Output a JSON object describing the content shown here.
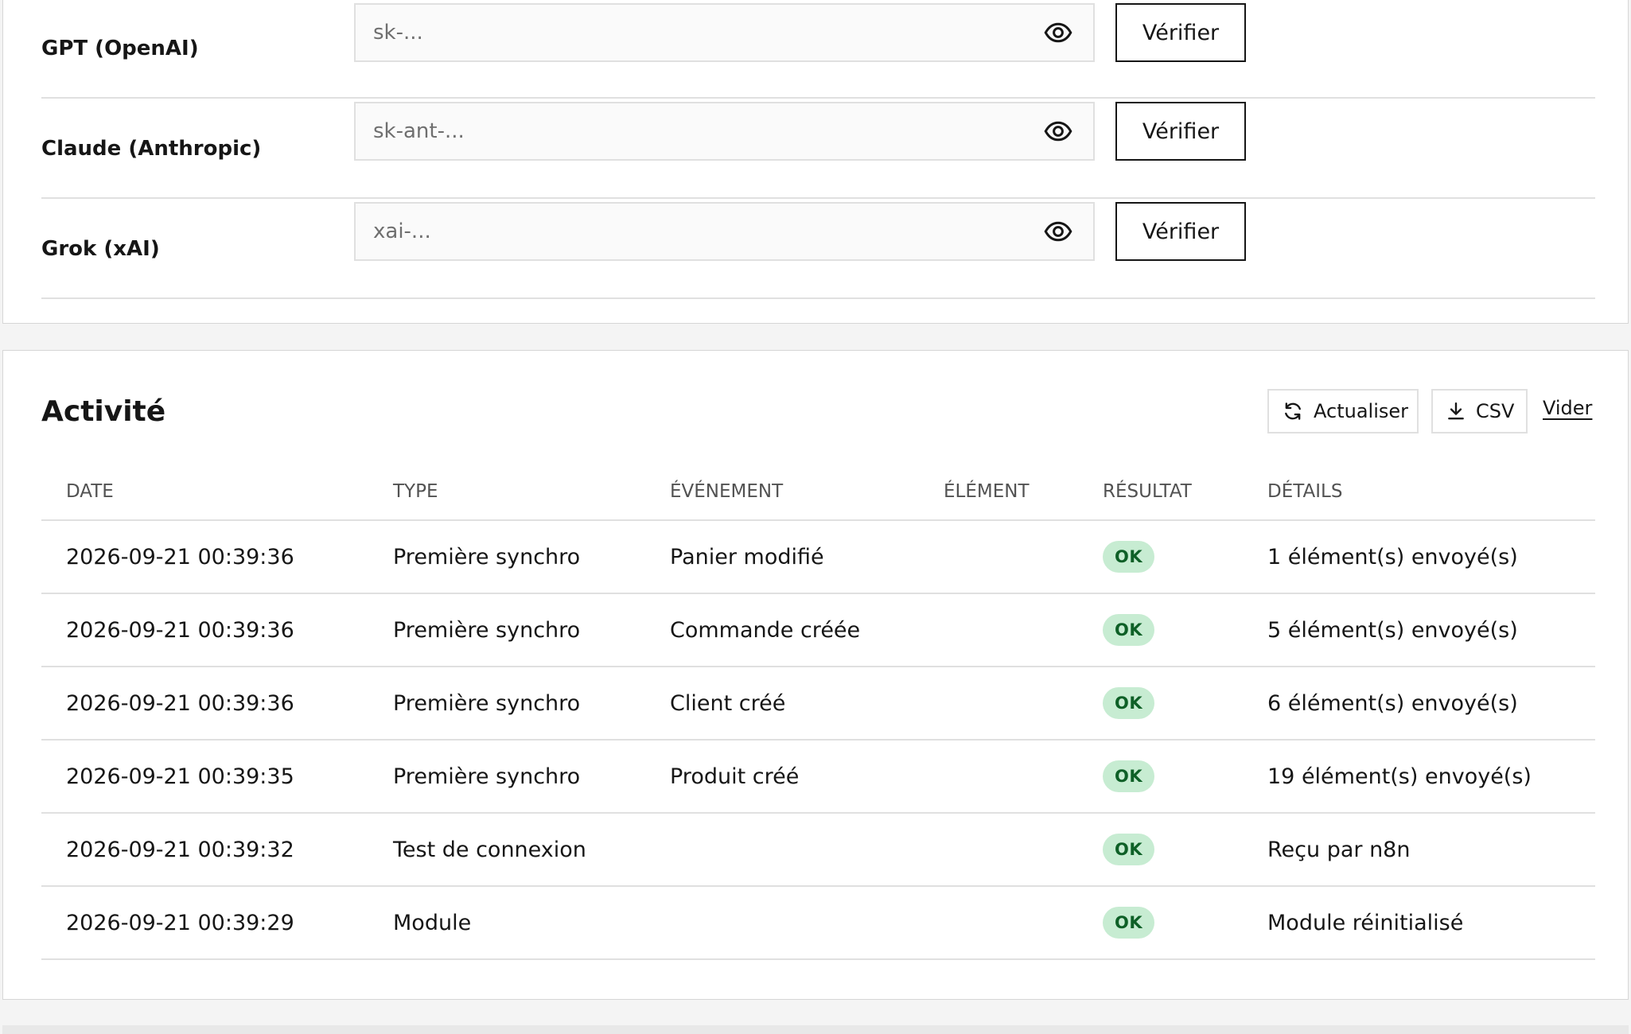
{
  "api_keys": [
    {
      "label": "GPT (OpenAI)",
      "value": "",
      "placeholder": "sk-...",
      "verify_label": "Vérifier"
    },
    {
      "label": "Claude (Anthropic)",
      "value": "",
      "placeholder": "sk-ant-...",
      "verify_label": "Vérifier"
    },
    {
      "label": "Grok (xAI)",
      "value": "",
      "placeholder": "xai-...",
      "verify_label": "Vérifier"
    }
  ],
  "activity": {
    "title": "Activité",
    "refresh_label": "Actualiser",
    "csv_label": "CSV",
    "clear_label": "Vider",
    "refresh_icon": "refresh-icon",
    "csv_icon": "download-icon",
    "columns": {
      "date": "DATE",
      "type": "TYPE",
      "event": "ÉVÉNEMENT",
      "element": "ÉLÉMENT",
      "result": "RÉSULTAT",
      "details": "DÉTAILS"
    },
    "rows": [
      {
        "date": "2026-09-21 00:39:36",
        "type": "Première synchro",
        "event": "Panier modifié",
        "element": "",
        "result": "OK",
        "details": "1 élément(s) envoyé(s)"
      },
      {
        "date": "2026-09-21 00:39:36",
        "type": "Première synchro",
        "event": "Commande créée",
        "element": "",
        "result": "OK",
        "details": "5 élément(s) envoyé(s)"
      },
      {
        "date": "2026-09-21 00:39:36",
        "type": "Première synchro",
        "event": "Client créé",
        "element": "",
        "result": "OK",
        "details": "6 élément(s) envoyé(s)"
      },
      {
        "date": "2026-09-21 00:39:35",
        "type": "Première synchro",
        "event": "Produit créé",
        "element": "",
        "result": "OK",
        "details": "19 élément(s) envoyé(s)"
      },
      {
        "date": "2026-09-21 00:39:32",
        "type": "Test de connexion",
        "event": "",
        "element": "",
        "result": "OK",
        "details": "Reçu par n8n"
      },
      {
        "date": "2026-09-21 00:39:29",
        "type": "Module",
        "event": "",
        "element": "",
        "result": "OK",
        "details": "Module réinitialisé"
      }
    ]
  },
  "colors": {
    "ok_badge_bg": "#c7ecd2",
    "ok_badge_text": "#0e6027",
    "text_primary": "#161616",
    "border": "#e0e0e0"
  }
}
